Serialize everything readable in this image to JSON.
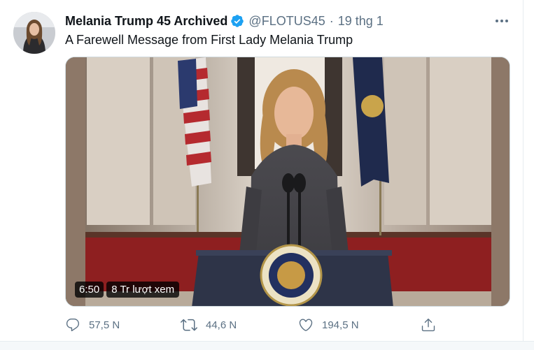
{
  "tweet": {
    "display_name": "Melania Trump 45 Archived",
    "verified_icon": "verified-badge-icon",
    "handle": "@FLOTUS45",
    "separator": "·",
    "timestamp": "19 thg 1",
    "text": "A Farewell Message from First Lady Melania Trump",
    "more_icon": "more-options-icon"
  },
  "video": {
    "duration": "6:50",
    "views": "8 Tr lượt xem"
  },
  "actions": {
    "reply_count": "57,5 N",
    "retweet_count": "44,6 N",
    "like_count": "194,5 N"
  },
  "colors": {
    "secondary_text": "#5b7083",
    "verified_blue": "#1da1f2",
    "border": "#cfd9de"
  }
}
